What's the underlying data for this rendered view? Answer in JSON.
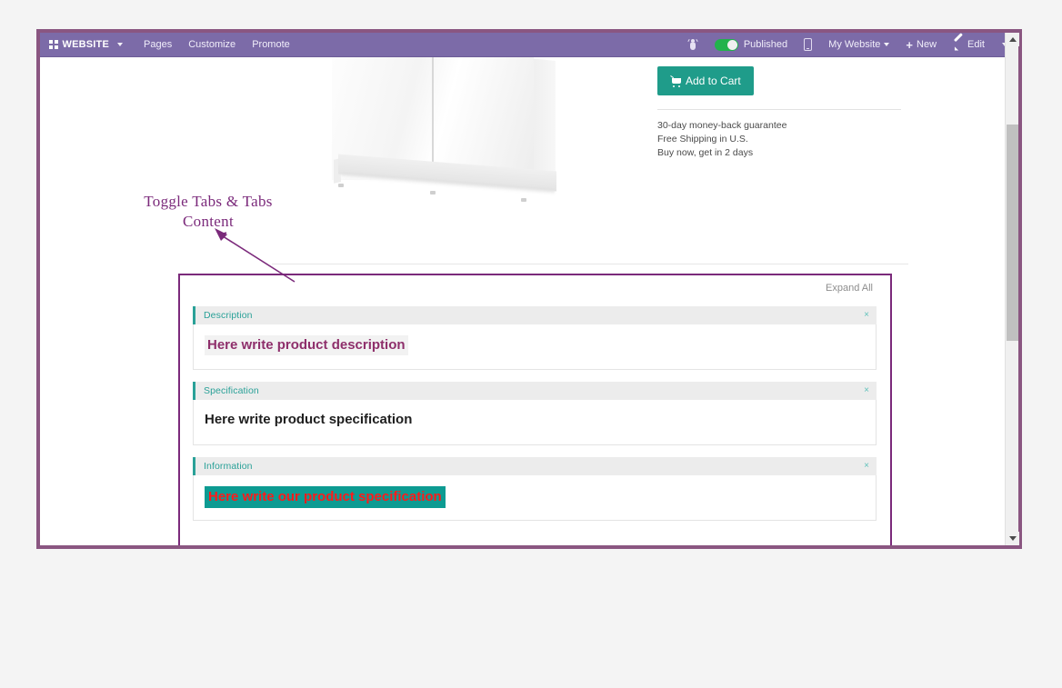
{
  "topbar": {
    "brand": "WEBSITE",
    "brand_icon": "apps-grid-icon",
    "menu": [
      "Pages",
      "Customize",
      "Promote"
    ],
    "debug_icon": "bug-icon",
    "publish_toggle": {
      "label": "Published",
      "state": "on",
      "color": "#22b24c"
    },
    "mobile_preview_icon": "mobile-phone-icon",
    "site_selector": "My Website",
    "new_label": "New",
    "new_icon": "plus-icon",
    "edit_label": "Edit",
    "edit_icon": "pencil-icon",
    "background_color": "#7c6ba8"
  },
  "product": {
    "image_alt": "white two-door cabinet",
    "add_to_cart_label": "Add to Cart",
    "add_to_cart_icon": "shopping-cart-icon",
    "add_to_cart_color": "#1f9c8a",
    "guarantees": [
      "30-day money-back guarantee",
      "Free Shipping in U.S.",
      "Buy now, get in 2 days"
    ]
  },
  "annotation": {
    "text_line1": "Toggle Tabs & Tabs",
    "text_line2": "Content",
    "color": "#7b2a7b"
  },
  "tabs_section": {
    "expand_all_label": "Expand All",
    "accent_color": "#2aa198",
    "close_icon": "×",
    "tabs": [
      {
        "title": "Description",
        "content": "Here write product description",
        "content_style": "highlight-gray-purple-text"
      },
      {
        "title": "Specification",
        "content": "Here write product specification",
        "content_style": "plain-dark-text"
      },
      {
        "title": "Information",
        "content": "Here write our product specification",
        "content_style": "highlight-teal-red-text"
      }
    ]
  },
  "scrollbar": {
    "up_arrow_icon": "triangle-up-icon",
    "down_arrow_icon": "triangle-down-icon",
    "thumb": "scrollbar-thumb"
  }
}
